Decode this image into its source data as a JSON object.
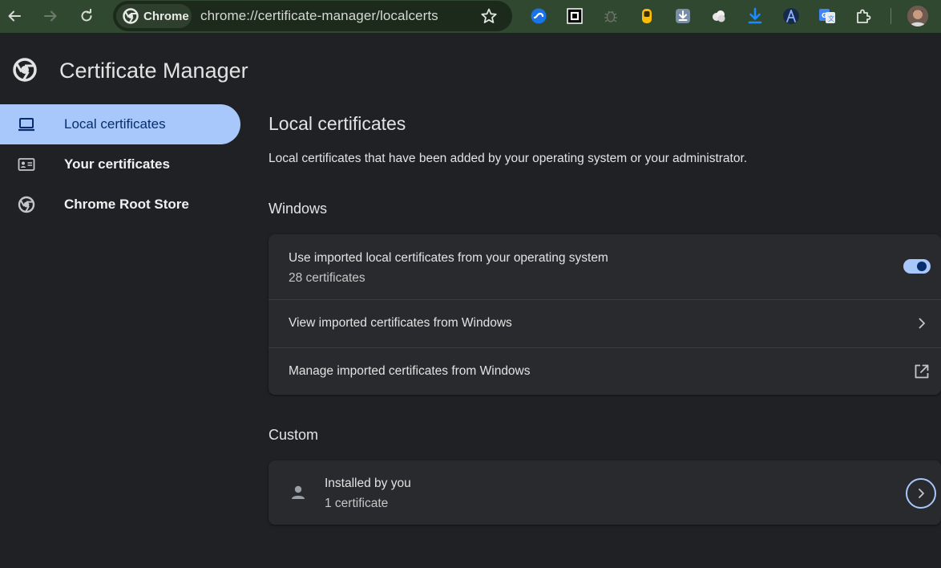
{
  "browser": {
    "chip_label": "Chrome",
    "url": "chrome://certificate-manager/localcerts"
  },
  "header": {
    "title": "Certificate Manager"
  },
  "sidebar": {
    "items": [
      {
        "label": "Local certificates",
        "icon": "laptop-icon",
        "active": true
      },
      {
        "label": "Your certificates",
        "icon": "id-card-icon",
        "active": false
      },
      {
        "label": "Chrome Root Store",
        "icon": "chrome-icon",
        "active": false
      }
    ]
  },
  "main": {
    "title": "Local certificates",
    "description": "Local certificates that have been added by your operating system or your administrator.",
    "windows_section": {
      "title": "Windows",
      "use_imported": {
        "label": "Use imported local certificates from your operating system",
        "sub": "28 certificates",
        "toggle_on": true
      },
      "view_imported": {
        "label": "View imported certificates from Windows"
      },
      "manage_imported": {
        "label": "Manage imported certificates from Windows"
      }
    },
    "custom_section": {
      "title": "Custom",
      "installed": {
        "label": "Installed by you",
        "sub": "1 certificate"
      }
    }
  },
  "colors": {
    "accent": "#a8c7fa",
    "toolbar_bg": "#314830",
    "page_bg": "#202124",
    "card_bg": "#292a2d"
  }
}
